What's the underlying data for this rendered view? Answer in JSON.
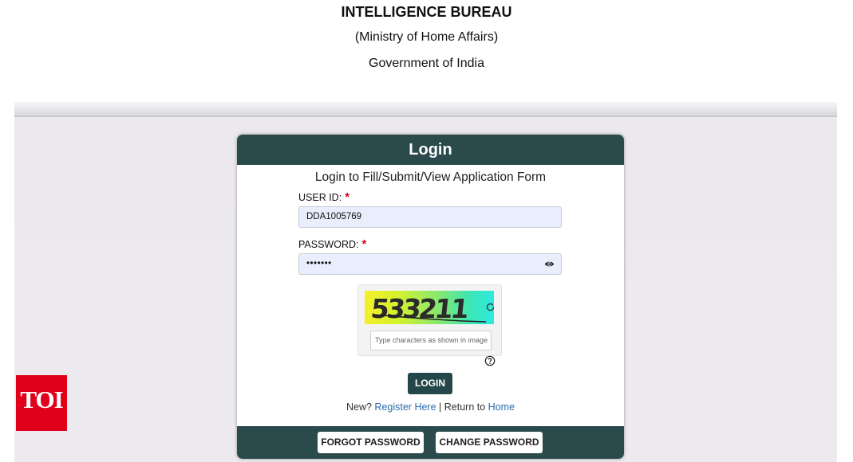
{
  "header": {
    "line1": "INTELLIGENCE BUREAU",
    "line2": "(Ministry of Home Affairs)",
    "line3": "Government of India"
  },
  "login_card": {
    "title": "Login",
    "subtitle": "Login to Fill/Submit/View Application Form",
    "user_id_label": "USER ID:",
    "required_mark": "*",
    "user_id_value": "DDA1005769",
    "password_label": "PASSWORD:",
    "password_value": "•••••••",
    "captcha_text": "533211",
    "captcha_placeholder": "Type characters as shown in image",
    "login_button": "LOGIN",
    "new_prefix": "New?",
    "register_link": "Register Here",
    "separator": "|",
    "return_text": "Return to",
    "home_link": "Home",
    "forgot_password_button": "FORGOT PASSWORD",
    "change_password_button": "CHANGE PASSWORD"
  },
  "icons": {
    "eye": "eye-icon",
    "refresh": "refresh-icon",
    "help": "help-icon"
  },
  "watermark": {
    "text": "TOI"
  },
  "colors": {
    "card_header": "#2a4a4c",
    "login_button": "#24474a",
    "link": "#2b6cb0",
    "required": "#d0021b",
    "input_bg": "#e8eefb",
    "watermark_bg": "#e1001a"
  }
}
